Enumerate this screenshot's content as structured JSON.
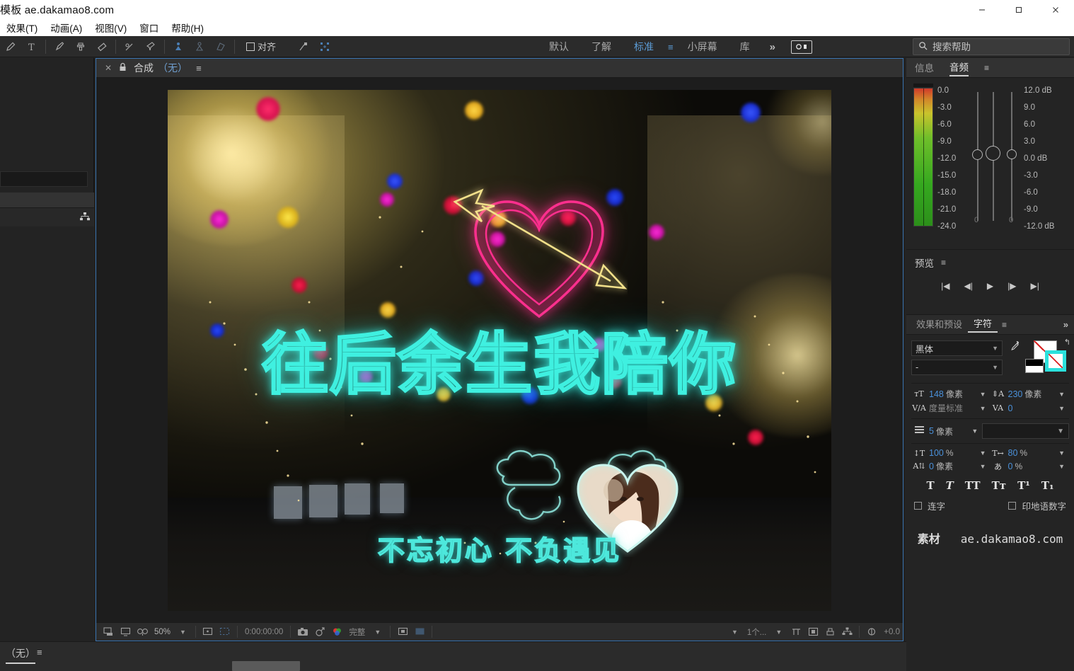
{
  "window": {
    "title": "模板 ae.dakamao8.com",
    "minimize": "—",
    "maximize": "❐",
    "close": "✕"
  },
  "menu": {
    "items": [
      {
        "label": "效果(T)"
      },
      {
        "label": "动画(A)"
      },
      {
        "label": "视图(V)"
      },
      {
        "label": "窗口"
      },
      {
        "label": "帮助(H)"
      }
    ]
  },
  "toolbar": {
    "align_label": "对齐",
    "icons": [
      "pen-icon",
      "text-icon",
      "brush-icon",
      "clone-stamp-icon",
      "eraser-icon",
      "roto-brush-icon",
      "puppet-pin-icon",
      "puppet-starch-icon",
      "puppet-overlap-icon",
      "puppet-bend-icon",
      "snapping-icon",
      "transform-box-icon"
    ]
  },
  "workspaces": {
    "items": [
      {
        "label": "默认",
        "active": false
      },
      {
        "label": "了解",
        "active": false
      },
      {
        "label": "标准",
        "active": true
      },
      {
        "label": "小屏幕",
        "active": false
      },
      {
        "label": "库",
        "active": false
      }
    ],
    "overflow": "»",
    "hamburger": "≡",
    "capture_icon": "screen-capture-icon"
  },
  "search": {
    "placeholder": "搜索帮助",
    "value": "",
    "icon": "search-icon"
  },
  "composition": {
    "close_icon": "✕",
    "lock_icon": "lock-icon",
    "tab_title": "合成",
    "tab_sub": "（无）",
    "menu_icon": "≡",
    "main_text": "往后余生我陪你",
    "sub_text": "不忘初心 不负遇见",
    "bottom_bar": {
      "zoom": "50%",
      "timecode": "0:00:00:00",
      "resolution": "完整",
      "view_count": "1个...",
      "exposure": "+0.0",
      "icons": [
        "always-preview-icon",
        "main-view-icon",
        "3d-glasses-icon",
        "region-of-interest-icon",
        "transparency-grid-icon",
        "snapshot-icon",
        "show-snapshot-icon",
        "channel-icon",
        "toggle-mask-icon",
        "toggle-guides-icon",
        "timeline-icon",
        "comp-flowchart-icon",
        "reset-exposure-icon",
        "renderer-icon",
        "3d-view-icon"
      ]
    }
  },
  "audio_panel": {
    "tabs": [
      {
        "label": "信息",
        "active": false
      },
      {
        "label": "音频",
        "active": true
      }
    ],
    "menu_icon": "≡",
    "left_scale": [
      "0.0",
      "-3.0",
      "-6.0",
      "-9.0",
      "-12.0",
      "-15.0",
      "-18.0",
      "-21.0",
      "-24.0"
    ],
    "right_scale": [
      "12.0 dB",
      "9.0",
      "6.0",
      "3.0",
      "0.0 dB",
      "-3.0",
      "-6.0",
      "-9.0",
      "-12.0 dB"
    ],
    "fader_values": [
      "0",
      "0"
    ]
  },
  "preview_panel": {
    "title": "预览",
    "menu_icon": "≡",
    "transport": [
      {
        "icon": "first-frame-icon",
        "glyph": "|◀"
      },
      {
        "icon": "previous-frame-icon",
        "glyph": "◀|"
      },
      {
        "icon": "play-icon",
        "glyph": "▶"
      },
      {
        "icon": "next-frame-icon",
        "glyph": "|▶"
      },
      {
        "icon": "last-frame-icon",
        "glyph": "▶|"
      }
    ]
  },
  "character_panel": {
    "tabs": [
      {
        "label": "效果和预设",
        "active": false
      },
      {
        "label": "字符",
        "active": true
      }
    ],
    "menu_icon": "≡",
    "overflow_icon": "»",
    "font_family": "黑体",
    "font_style": "-",
    "eyedropper_icon": "eyedropper-icon",
    "fill_swatch": "none",
    "stroke_swatch": "#2BE0DC",
    "font_size": {
      "value": "148",
      "unit": "像素",
      "icon": "font-size-icon"
    },
    "leading": {
      "value": "230",
      "unit": "像素",
      "icon": "leading-icon"
    },
    "kerning": {
      "value": "度量标准",
      "icon": "kerning-icon"
    },
    "tracking": {
      "value": "0",
      "icon": "tracking-icon"
    },
    "stroke_width": {
      "value": "5",
      "unit": "像素",
      "icon": "stroke-width-icon"
    },
    "stroke_type": "",
    "vertical_scale": {
      "value": "100",
      "unit": "%",
      "icon": "vertical-scale-icon"
    },
    "horizontal_scale": {
      "value": "80",
      "unit": "%",
      "icon": "horizontal-scale-icon"
    },
    "baseline_shift": {
      "value": "0",
      "unit": "像素",
      "icon": "baseline-shift-icon"
    },
    "tsume": {
      "value": "0",
      "unit": "%",
      "icon": "tsume-icon"
    },
    "style_buttons": [
      {
        "label": "T",
        "icon": "faux-bold-icon"
      },
      {
        "label": "T",
        "icon": "faux-italic-icon"
      },
      {
        "label": "TT",
        "icon": "all-caps-icon"
      },
      {
        "label": "Tᴛ",
        "icon": "small-caps-icon"
      },
      {
        "label": "T¹",
        "icon": "superscript-icon"
      },
      {
        "label": "T₁",
        "icon": "subscript-icon"
      }
    ],
    "ligatures_label": "连字",
    "hindi_digits_label": "印地语数字",
    "watermark_prefix": "素材",
    "watermark_url": "ae.dakamao8.com"
  },
  "timeline": {
    "tab_label": "（无）",
    "menu_icon": "≡"
  },
  "colors": {
    "accent_blue": "#5B9BD5",
    "panel_bg": "#242424",
    "neon_cyan": "#3FF0E0",
    "neon_pink": "#FF2F8E",
    "neon_gold": "#F2E08A"
  }
}
